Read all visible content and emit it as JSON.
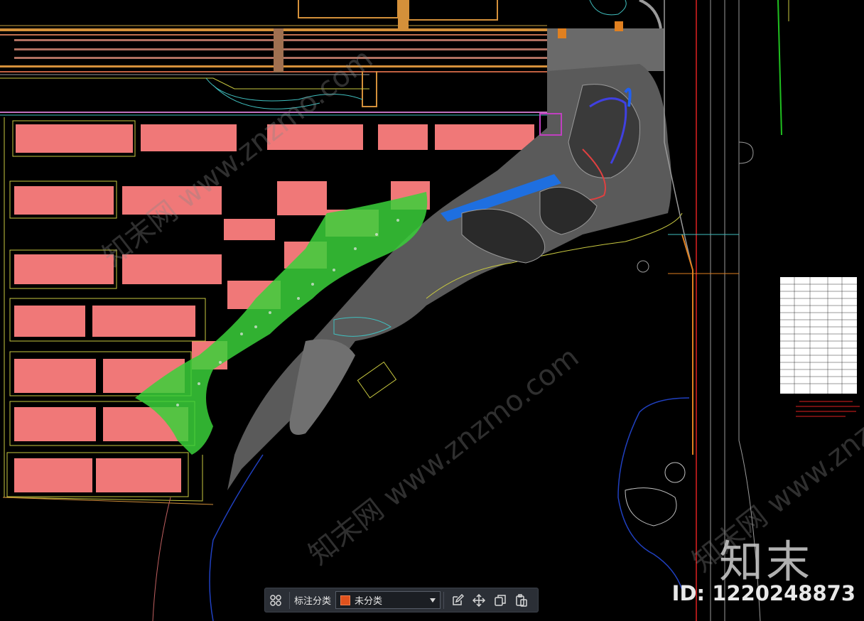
{
  "toolbar": {
    "category_label": "标注分类",
    "category_value": "未分类",
    "swatch_color": "#e0521d",
    "icons": [
      "grid-icon",
      "edit-icon",
      "move-icon",
      "copy-icon",
      "paste-icon"
    ]
  },
  "watermark": {
    "logo_text": "知末",
    "id_text": "ID: 1220248873",
    "diagonal_text": "知末网 www.znzmo.com"
  },
  "colors": {
    "background": "#000000",
    "building": "#f07878",
    "road": "#8a8a8a",
    "water_blue": "#1e6fe0",
    "vegetation": "#3ad03a",
    "road_orange": "#d4903a",
    "lake_edge": "#2040c0"
  }
}
